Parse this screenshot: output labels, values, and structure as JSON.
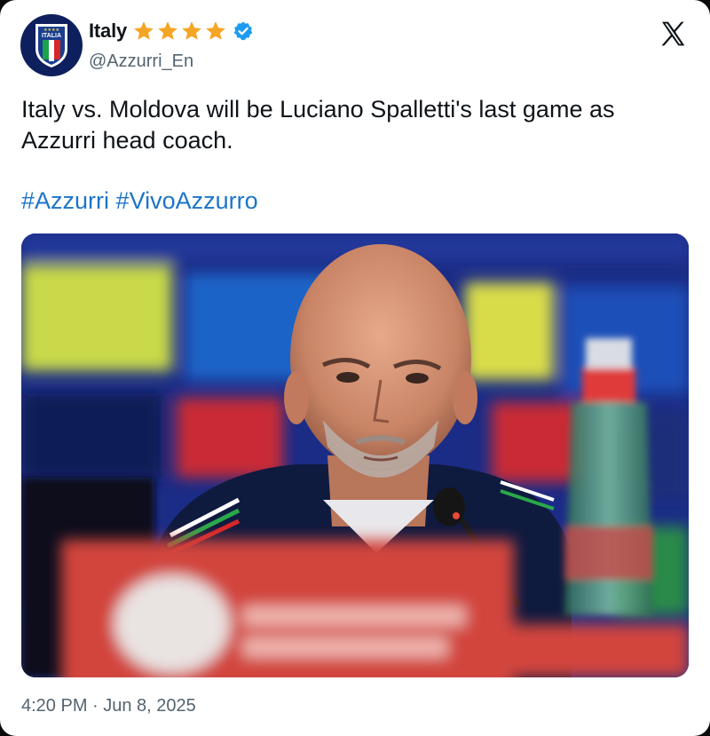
{
  "account": {
    "name": "Italy",
    "handle": "@Azzurri_En",
    "avatar_label": "ITALIA",
    "rating_stars": 4,
    "verified": true
  },
  "tweet": {
    "text": "Italy vs. Moldova will be Luciano Spalletti's last game as Azzurri head coach.",
    "hashtags": [
      "#Azzurri",
      "#VivoAzzurro"
    ],
    "timestamp": "4:20 PM · Jun 8, 2025"
  },
  "colors": {
    "link": "#1d74c9",
    "verified": "#1d9bf0",
    "star": "#f5a524",
    "avatar_bg": "#0d1f5c"
  },
  "icons": {
    "platform": "x-logo-icon",
    "verified": "verified-badge-icon",
    "rating": "star-icon"
  }
}
